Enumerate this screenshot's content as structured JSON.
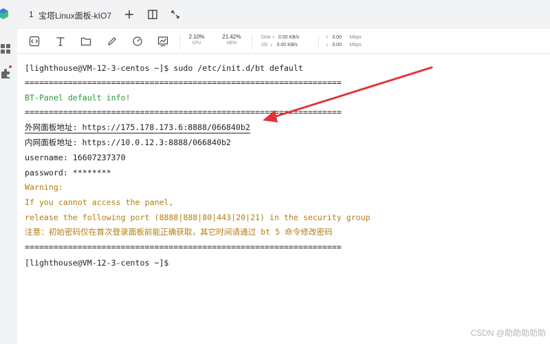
{
  "tab": {
    "index": "1",
    "title": "宝塔Linux面板-kIO7"
  },
  "stats": {
    "cpu": {
      "value": "2.10%",
      "label": "CPU"
    },
    "mem": {
      "value": "21.42%",
      "label": "MEM"
    },
    "disk": {
      "label_top": "Disk",
      "label_bottom": "I/O",
      "read": "0.00 KB/s",
      "write": "0.00 KB/s"
    },
    "net": {
      "up": "0.00",
      "down": "0.00",
      "unit": "Mbps"
    }
  },
  "terminal": {
    "lines": [
      "[lighthouse@VM-12-3-centos ~]$ sudo /etc/init.d/bt default",
      "==================================================================",
      "BT-Panel default info!",
      "==================================================================",
      "外网面板地址: https://175.178.173.6:8888/066840b2",
      "内网面板地址: https://10.0.12.3:8888/066840b2",
      "username: 16607237370",
      "password: ********",
      "Warning:",
      "If you cannot access the panel,",
      "release the following port (8888|888|80|443|20|21) in the security group",
      "注意：初始密码仅在首次登录面板前能正确获取，其它时间请通过 bt 5 命令修改密码",
      "==================================================================",
      "[lighthouse@VM-12-3-centos ~]$"
    ]
  },
  "watermark": "CSDN @助助助助助",
  "colors": {
    "accent_arrow": "#e0343a",
    "success": "#2a9a3a",
    "warning": "#b27e10"
  }
}
